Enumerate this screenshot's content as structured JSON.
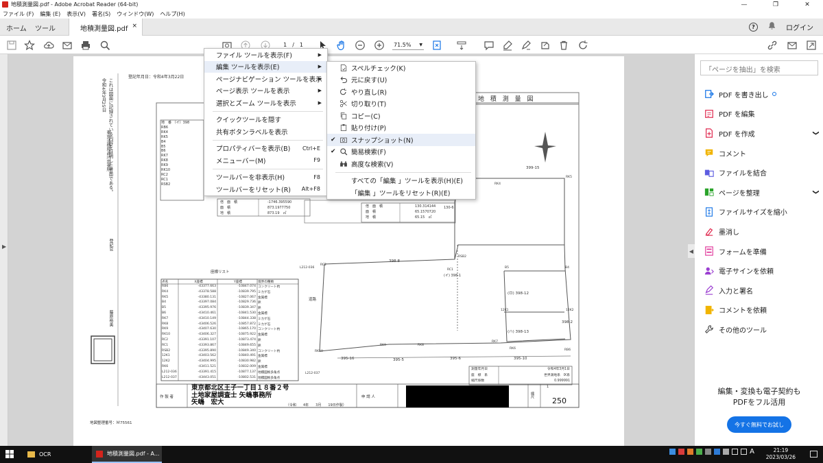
{
  "window": {
    "title": "地積測量図.pdf - Adobe Acrobat Reader (64-bit)",
    "controls": [
      "—",
      "❐",
      "✕"
    ]
  },
  "menubar": [
    "ファイル (F)",
    "編集 (E)",
    "表示(V)",
    "署名(S)",
    "ウィンドウ(W)",
    "ヘルプ(H)"
  ],
  "tabs": {
    "home": "ホーム",
    "tools": "ツール",
    "document": "地積測量図.pdf",
    "close": "×",
    "help": "?",
    "login": "ログイン"
  },
  "toolbar": {
    "page_current": "1",
    "page_sep": "/",
    "page_total": "1",
    "zoom": "71.5%"
  },
  "menu_view": {
    "items": [
      {
        "label": "ファイル ツールを表示(F)",
        "shortcut": "",
        "submenu": true
      },
      {
        "label": "編集 ツールを表示(E)",
        "shortcut": "",
        "submenu": true,
        "highlight": true
      },
      {
        "label": "ページナビゲーション ツールを表示",
        "shortcut": "",
        "submenu": true
      },
      {
        "label": "ページ表示 ツールを表示",
        "shortcut": "",
        "submenu": true
      },
      {
        "label": "選択とズーム ツールを表示",
        "shortcut": "",
        "submenu": true
      },
      {
        "sep": true
      },
      {
        "label": "クイックツールを隠す",
        "shortcut": ""
      },
      {
        "label": "共有ボタンラベルを表示",
        "shortcut": ""
      },
      {
        "sep": true
      },
      {
        "label": "プロパティバーを表示(B)",
        "shortcut": "Ctrl+E"
      },
      {
        "label": "メニューバー(M)",
        "shortcut": "F9"
      },
      {
        "sep": true
      },
      {
        "label": "ツールバーを非表示(H)",
        "shortcut": "F8"
      },
      {
        "label": "ツールバーをリセット(R)",
        "shortcut": "Alt+F8"
      }
    ]
  },
  "menu_edit": {
    "items": [
      {
        "label": "スペルチェック(K)",
        "icon": "spellcheck-icon"
      },
      {
        "label": "元に戻す(U)",
        "icon": "undo-icon"
      },
      {
        "label": "やり直し(R)",
        "icon": "redo-icon"
      },
      {
        "label": "切り取り(T)",
        "icon": "scissors-icon"
      },
      {
        "label": "コピー(C)",
        "icon": "copy-icon"
      },
      {
        "label": "貼り付け(P)",
        "icon": "paste-icon"
      },
      {
        "label": "スナップショット(N)",
        "icon": "camera-icon",
        "checked": true,
        "highlight": true
      },
      {
        "label": "簡易検索(F)",
        "icon": "search-icon",
        "checked": true
      },
      {
        "label": "高度な検索(V)",
        "icon": "binoculars-icon"
      },
      {
        "sep": true
      },
      {
        "label": "すべての「編集 」ツールを表示(H)(E)",
        "icon": ""
      },
      {
        "label": "「編集 」ツールをリセット(R)(E)",
        "icon": ""
      }
    ]
  },
  "right_panel": {
    "search_placeholder": "「ページを抽出」を検索",
    "tools": [
      {
        "label": "PDF を書き出し",
        "color": "#1473e6",
        "icon": "export-pdf-icon",
        "dot": true
      },
      {
        "label": "PDF を編集",
        "color": "#e02b50",
        "icon": "edit-pdf-icon"
      },
      {
        "label": "PDF を作成",
        "color": "#e02b50",
        "icon": "create-pdf-icon",
        "chevron": true
      },
      {
        "label": "コメント",
        "color": "#f1b400",
        "icon": "comment-icon"
      },
      {
        "label": "ファイルを結合",
        "color": "#5c5ce0",
        "icon": "combine-icon"
      },
      {
        "label": "ページを整理",
        "color": "#2aa32a",
        "icon": "organize-icon",
        "chevron": true
      },
      {
        "label": "ファイルサイズを縮小",
        "color": "#1473e6",
        "icon": "compress-icon"
      },
      {
        "label": "墨消し",
        "color": "#e02b50",
        "icon": "redact-icon"
      },
      {
        "label": "フォームを準備",
        "color": "#e0399b",
        "icon": "form-icon"
      },
      {
        "label": "電子サインを依頼",
        "color": "#9b3fd1",
        "icon": "request-sign-icon"
      },
      {
        "label": "入力と署名",
        "color": "#9b3fd1",
        "icon": "fill-sign-icon"
      },
      {
        "label": "コメントを依頼",
        "color": "#f1b400",
        "icon": "request-comment-icon"
      },
      {
        "label": "その他のツール",
        "color": "#555555",
        "icon": "more-tools-icon"
      }
    ],
    "chevron": "❯",
    "promo_line1": "編集・変換も電子契約も",
    "promo_line2": "PDFをフル活用",
    "promo_button": "今すぐ無料でお試し"
  },
  "taskbar": {
    "items": [
      "OCR",
      "地積測量図.pdf - A..."
    ],
    "time": "21:19",
    "date": "2023/03/26",
    "ime": "A"
  },
  "document": {
    "registered": "登記年月日：令和4年3月22日",
    "title": "地 積 測 量 図",
    "left_vertical_1": "これは図面に記録されている内容を証明した書面である。",
    "left_vertical_2": "令和4年3月25日",
    "left_vertical_3": "東京法務局品川出張所",
    "stamp_label": "登記官",
    "official": "藤原裕美",
    "coord_title": "座標リスト",
    "coord_headers": [
      "点名",
      "X座標",
      "Y座標",
      "境界の種類"
    ],
    "coord_rows": [
      [
        "RB6",
        "-43377.663",
        "-10847.074",
        "コンクリート杭"
      ],
      [
        "RK4",
        "-43378.588",
        "-10839.795",
        "ミカゲ石"
      ],
      [
        "RK5",
        "-43380.131",
        "-10827.067",
        "金属標"
      ],
      [
        "B4",
        "-43397.084",
        "-10829.736",
        "鋲"
      ],
      [
        "B5",
        "-43395.976",
        "-10839.347",
        "鋲"
      ],
      [
        "B6",
        "-43410.461",
        "-10841.530",
        "金属標"
      ],
      [
        "RK7",
        "-43410.149",
        "-10844.338",
        "ミカゲ石"
      ],
      [
        "RK8",
        "-43406.526",
        "-10857.872",
        "ミカゲ石"
      ],
      [
        "RK9",
        "-43407.630",
        "-10865.170",
        "コンクリート杭"
      ],
      [
        "RK10",
        "-43406.327",
        "-10875.922",
        "金属標"
      ],
      [
        "RC2",
        "-43391.107",
        "-10873.474",
        "鋲"
      ],
      [
        "RC1",
        "-43393.867",
        "-10849.655",
        "鋲"
      ],
      [
        "RSB2",
        "-43395.890",
        "-10849.340",
        "コンクリート杭"
      ],
      [
        "12K1",
        "-43403.562",
        "-10840.491",
        "金属標"
      ],
      [
        "12K2",
        "-43404.995",
        "-10830.982",
        "鋲"
      ],
      [
        "RK6",
        "-43411.521",
        "-10832.009",
        "金属標"
      ],
      [
        "L212-036",
        "-43391.415",
        "-10877.137",
        "地積図根多角点"
      ],
      [
        "L212-037",
        "-43443.051",
        "-10802.531",
        "地積図根多角点"
      ]
    ],
    "top_table_head": [
      "地　番",
      "（イ）398"
    ],
    "top_table_rows": [
      "RB6",
      "RK4",
      "RK5",
      "B4",
      "B5",
      "B6",
      "RK7",
      "RK8",
      "RK9",
      "RK10",
      "RC2",
      "RC1",
      "RSB2"
    ],
    "area_a_labels": [
      "倍　面　積",
      "面　積",
      "地　積"
    ],
    "area_a_values": [
      "-1746.395590",
      "873.1977750",
      "873.19　㎡"
    ],
    "area_b_values": [
      "130.314144",
      "65.1570720",
      "65.15　㎡"
    ],
    "map_labels": [
      "399-15",
      "398-8",
      "道路",
      "(ロ) 398-12",
      "(ハ) 398-13",
      "398-2",
      "395-16",
      "395-5",
      "395-6",
      "395-10",
      "130-6",
      "(イ) 398-1"
    ],
    "map_points": [
      "RK4",
      "RK5",
      "RSB2",
      "RC1",
      "RC2",
      "B5",
      "B4",
      "12K1",
      "12K2",
      "RK7",
      "RK6",
      "RB6",
      "RK10",
      "RK9",
      "RK8",
      "L212-036",
      "L212-037"
    ],
    "info_rows": [
      [
        "測量年月日",
        "令和4年3月1日"
      ],
      [
        "座　標　系",
        "世界測地系　Ⅸ系"
      ],
      [
        "縮尺係数",
        "0.999991"
      ]
    ],
    "author_label": "作 製 者",
    "address": "東京都北区王子一丁目１８番２号",
    "office": "土地家屋調査士 矢嶋事務所",
    "person": "矢嶋　宏大",
    "date_sign": "（令和　　4年　　3月　　19日作製）",
    "applicant_label": "申 請 人",
    "scale_label": "縮尺",
    "scale": "250",
    "page_no": "1",
    "map_no": "地図整理番号：Ｍ75561"
  }
}
